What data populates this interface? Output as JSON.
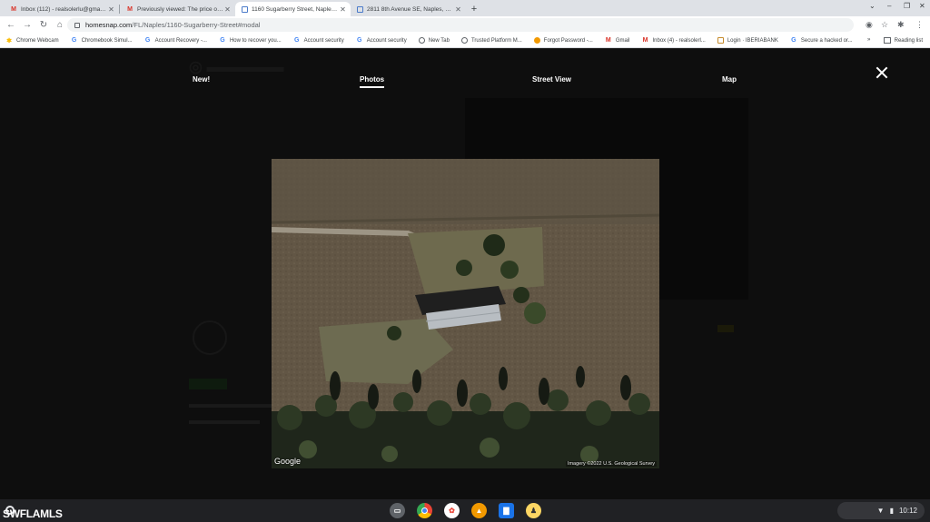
{
  "browser": {
    "tabs": [
      {
        "icon": "gmail-icon",
        "title": "Inbox (112) - realsolerlu@gmail...",
        "active": false
      },
      {
        "icon": "gmail-icon",
        "title": "Previously viewed: The price of t...",
        "active": false
      },
      {
        "icon": "homesnap-icon",
        "title": "1160 Sugarberry Street, Naples,...",
        "active": true
      },
      {
        "icon": "homesnap-icon",
        "title": "2811 8th Avenue SE, Naples, FL...",
        "active": false
      }
    ],
    "url_host": "homesnap.com",
    "url_path": "/FL/Naples/1160-Sugarberry-Street#modal",
    "bookmarks": [
      {
        "icon": "star",
        "label": "Chrome Webcam"
      },
      {
        "icon": "g",
        "label": "Chromebook Simul..."
      },
      {
        "icon": "g",
        "label": "Account Recovery -..."
      },
      {
        "icon": "g",
        "label": "How to recover you..."
      },
      {
        "icon": "g",
        "label": "Account security"
      },
      {
        "icon": "g",
        "label": "Account security"
      },
      {
        "icon": "circle",
        "label": "New Tab"
      },
      {
        "icon": "circle",
        "label": "Trusted Platform M..."
      },
      {
        "icon": "dot",
        "label": "Forgot Password -..."
      },
      {
        "icon": "m",
        "label": "Gmail"
      },
      {
        "icon": "m",
        "label": "Inbox (4) - realsolerl..."
      },
      {
        "icon": "box",
        "label": "Login · IBERIABANK"
      },
      {
        "icon": "g",
        "label": "Secure a hacked or..."
      }
    ],
    "bookmarks_overflow": "»",
    "reading_list": "Reading list"
  },
  "modal": {
    "tabs": [
      "New!",
      "Photos",
      "Street View",
      "Map"
    ],
    "active_tab": "Photos",
    "close_label": "✕",
    "photo": {
      "logo": "Google",
      "attribution": "Imagery ©2022 U.S. Geological Survey"
    }
  },
  "shelf": {
    "watermark": "SWFLAMLS",
    "apps": [
      {
        "name": "files-app",
        "color": "#5f6368"
      },
      {
        "name": "chrome-app",
        "color": "#ea4335"
      },
      {
        "name": "photos-app",
        "color": "#fbbc04"
      },
      {
        "name": "play-books-app",
        "color": "#f29900"
      },
      {
        "name": "files-folder-app",
        "color": "#1a73e8"
      },
      {
        "name": "linux-app",
        "color": "#fdd663"
      }
    ],
    "time": "10:12"
  }
}
